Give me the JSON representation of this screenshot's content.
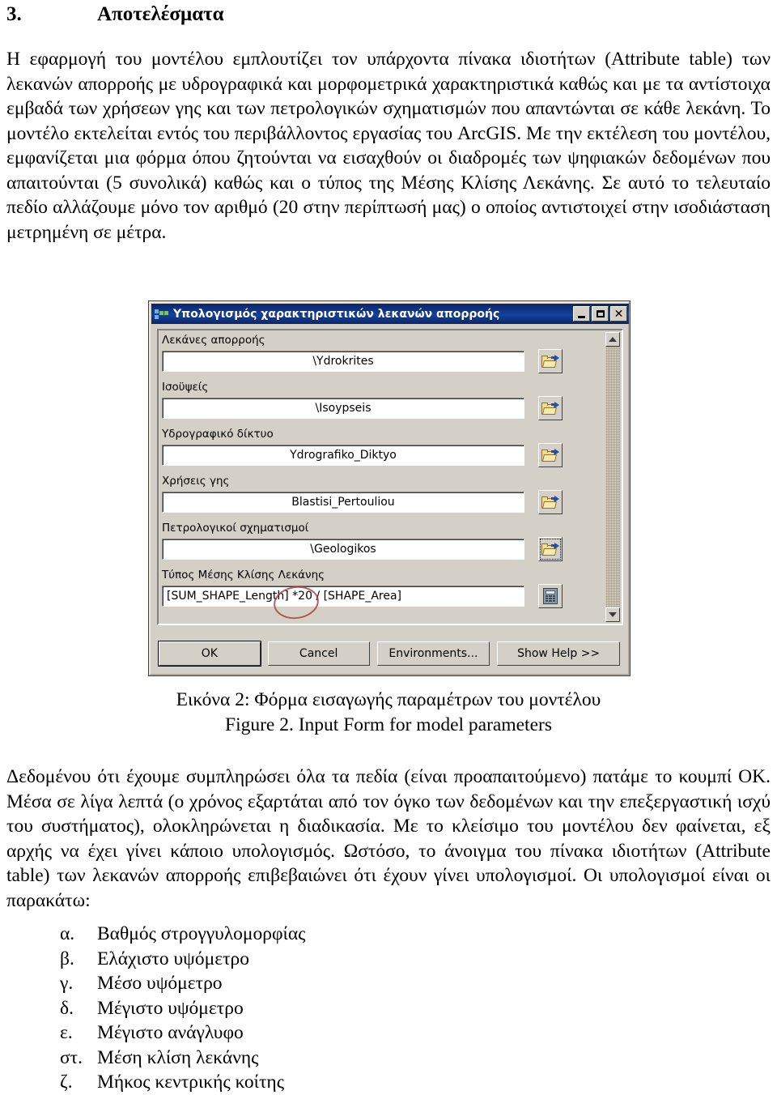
{
  "document": {
    "section_number": "3.",
    "section_title": "Αποτελέσματα",
    "paragraph_1": "Η εφαρμογή του μοντέλου εμπλουτίζει τον υπάρχοντα πίνακα ιδιοτήτων (Attribute table) των λεκανών απορροής με υδρογραφικά και μορφομετρικά χαρακτηριστικά καθώς και με τα αντίστοιχα εμβαδά των χρήσεων γης και των πετρολογικών σχηματισμών που απαντώνται σε κάθε λεκάνη. Το μοντέλο εκτελείται εντός του περιβάλλοντος εργασίας του ArcGIS. Με την εκτέλεση του μοντέλου, εμφανίζεται μια φόρμα όπου ζητούνται να εισαχθούν οι διαδρομές των ψηφιακών δεδομένων που απαιτούνται (5 συνολικά) καθώς και ο τύπος της Μέσης Κλίσης Λεκάνης. Σε αυτό το τελευταίο πεδίο αλλάζουμε μόνο τον αριθμό (20 στην περίπτωσή μας) ο οποίος αντιστοιχεί στην ισοδιάσταση μετρημένη σε μέτρα.",
    "paragraph_2": "Δεδομένου ότι έχουμε συμπληρώσει όλα τα πεδία (είναι προαπαιτούμενο) πατάμε το κουμπί ΟΚ. Μέσα σε λίγα λεπτά (ο χρόνος εξαρτάται από τον όγκο των δεδομένων και την επεξεργαστική ισχύ του συστήματος), ολοκληρώνεται η διαδικασία. Με το κλείσιμο του μοντέλου δεν φαίνεται, εξ αρχής να έχει γίνει κάποιο υπολογισμός. Ωστόσο, το άνοιγμα του πίνακα ιδιοτήτων (Attribute table) των λεκανών απορροής επιβεβαιώνει ότι έχουν γίνει υπολογισμοί. Οι υπολογισμοί είναι οι παρακάτω:",
    "caption_greek": "Εικόνα 2: Φόρμα εισαγωγής παραμέτρων του μοντέλου",
    "caption_english": "Figure 2. Input Form for model parameters",
    "list_items": [
      {
        "marker": "α.",
        "text": "Βαθμός στρογγυλομορφίας"
      },
      {
        "marker": "β.",
        "text": "Ελάχιστο υψόμετρο"
      },
      {
        "marker": "γ.",
        "text": "Μέσο υψόμετρο"
      },
      {
        "marker": "δ.",
        "text": "Μέγιστο υψόμετρο"
      },
      {
        "marker": "ε.",
        "text": "Μέγιστο ανάγλυφο"
      },
      {
        "marker": "στ.",
        "text": "Μέση κλίση λεκάνης"
      },
      {
        "marker": "ζ.",
        "text": "Μήκος κεντρικής κοίτης"
      }
    ]
  },
  "dialog": {
    "title": "Υπολογισμός χαρακτηριστικών λεκανών απορροής",
    "title_icon": "model-tool-icon",
    "window_controls": {
      "minimize": "minimize-icon",
      "maximize": "maximize-icon",
      "close": "close-icon"
    },
    "fields": [
      {
        "label": "Λεκάνες απορροής",
        "value": "\\Ydrokrites",
        "button_icon": "folder-open-icon",
        "focused": false
      },
      {
        "label": "Ισοϋψείς",
        "value": "\\Isoypseis",
        "button_icon": "folder-open-icon",
        "focused": false
      },
      {
        "label": "Υδρογραφικό δίκτυο",
        "value": "Ydrografiko_Diktyo",
        "button_icon": "folder-open-icon",
        "focused": false
      },
      {
        "label": "Χρήσεις γης",
        "value": "Blastisi_Pertouliou",
        "button_icon": "folder-open-icon",
        "focused": false
      },
      {
        "label": "Πετρολογικοί σχηματισμοί",
        "value": "\\Geologikos",
        "button_icon": "folder-open-icon",
        "focused": true
      }
    ],
    "formula_field": {
      "label": "Τύπος Μέσης Κλίσης Λεκάνης",
      "value": "[SUM_SHAPE_Length] *20 / [SHAPE_Area]",
      "button_icon": "calculator-icon",
      "annotation": "red-ellipse-around-20"
    },
    "buttons": [
      {
        "label": "OK",
        "name": "ok-button",
        "default": true
      },
      {
        "label": "Cancel",
        "name": "cancel-button",
        "default": false
      },
      {
        "label": "Environments...",
        "name": "environments-button",
        "default": false
      },
      {
        "label": "Show Help >>",
        "name": "show-help-button",
        "default": false
      }
    ],
    "scrollbar": {
      "up": "scroll-up-arrow-icon",
      "down": "scroll-down-arrow-icon"
    }
  },
  "colors": {
    "titlebar": "#0a246a",
    "dialog_face": "#d4d0c8",
    "annotation_red": "#b03a3a",
    "folder_yellow": "#f3dd8a"
  }
}
